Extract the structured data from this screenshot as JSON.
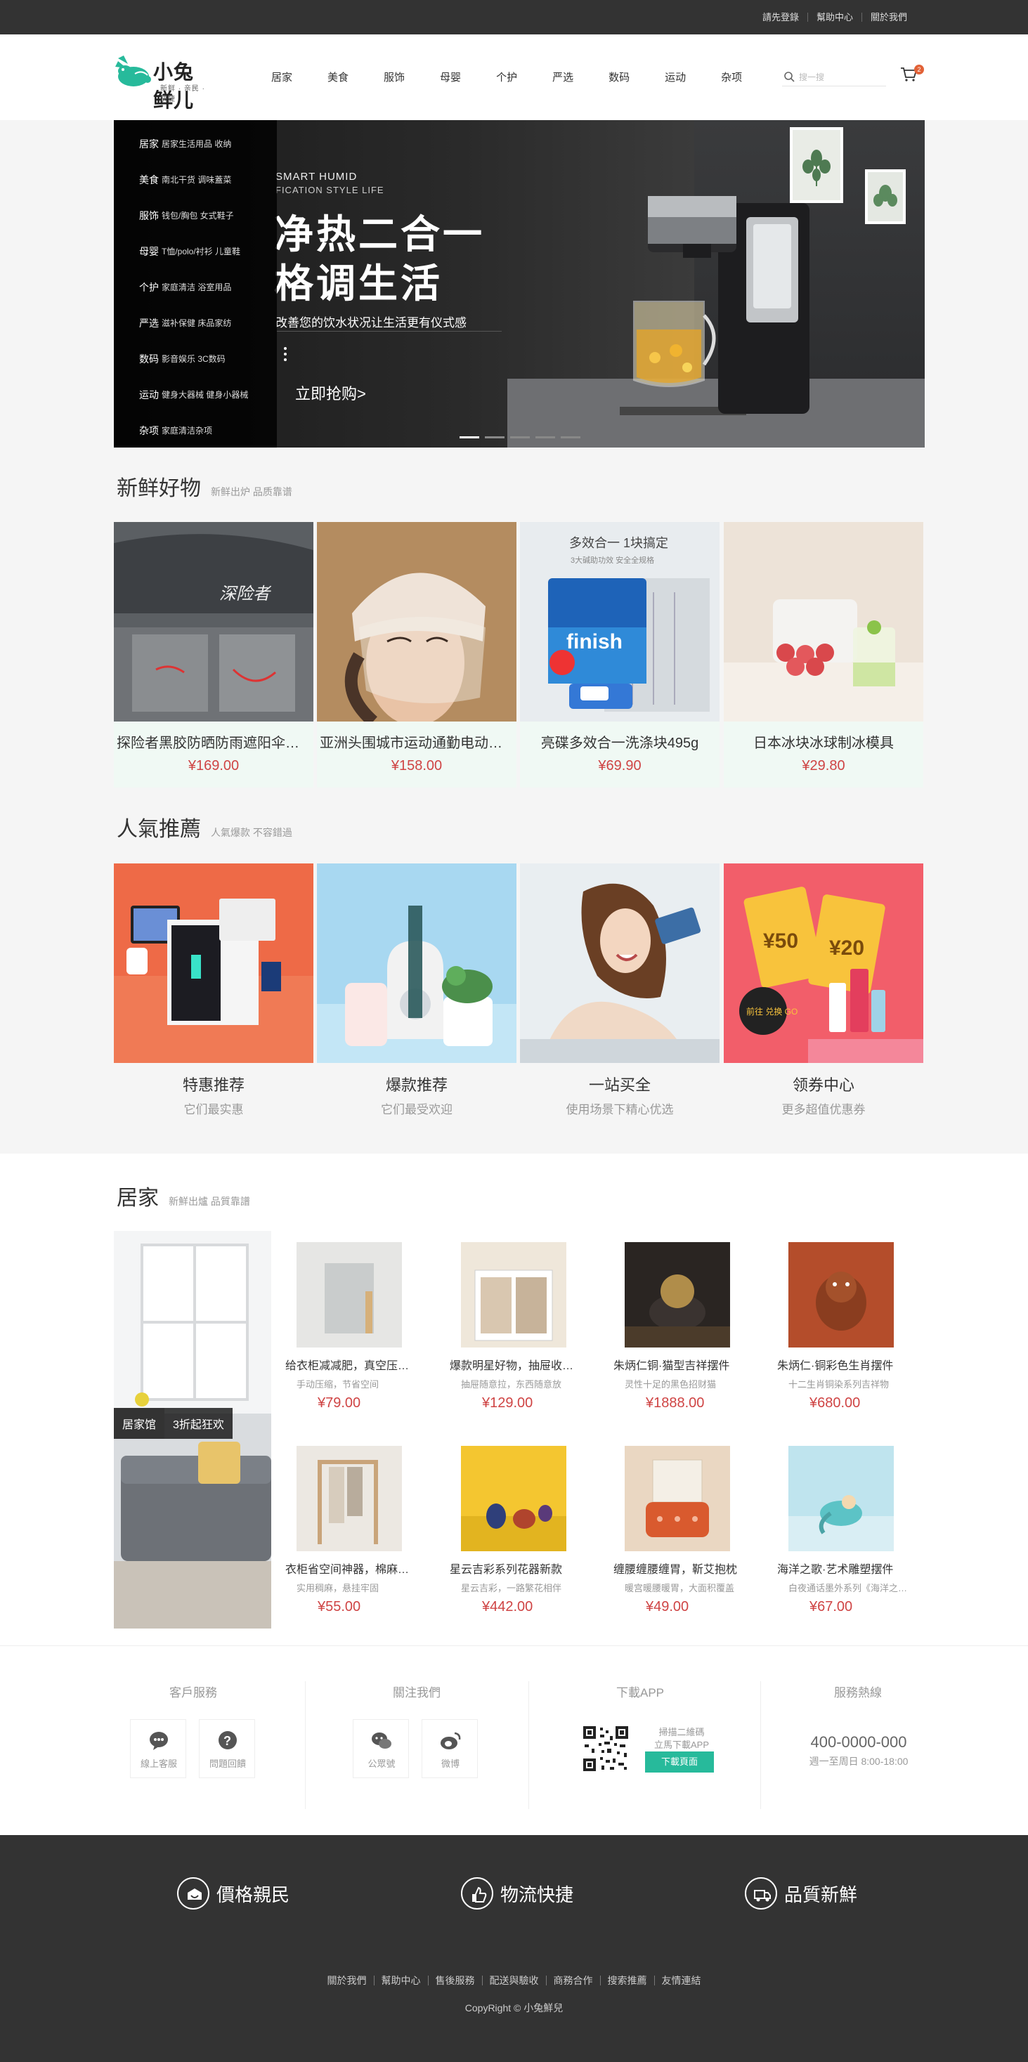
{
  "topbar": {
    "links": [
      "請先登錄",
      "幫助中心",
      "關於我們"
    ]
  },
  "header": {
    "logo_name": "小兔鲜儿",
    "logo_slogan": "新鲜 · 亲民 · 快捷",
    "nav": [
      "居家",
      "美食",
      "服饰",
      "母婴",
      "个护",
      "严选",
      "数码",
      "运动",
      "杂项"
    ],
    "search_placeholder": "搜一搜",
    "cart_count": "2"
  },
  "banner": {
    "categories": [
      {
        "name": "居家",
        "subs": "居家生活用品 收纳"
      },
      {
        "name": "美食",
        "subs": "南北干货 调味蓋菜"
      },
      {
        "name": "服饰",
        "subs": "钱包/胸包 女式鞋子"
      },
      {
        "name": "母婴",
        "subs": "T恤/polo/衬衫 儿童鞋"
      },
      {
        "name": "个护",
        "subs": "家庭清洁 浴室用品"
      },
      {
        "name": "严选",
        "subs": "滋补保健 床品家纺"
      },
      {
        "name": "数码",
        "subs": "影音娱乐 3C数码"
      },
      {
        "name": "运动",
        "subs": "健身大器械 健身小器械"
      },
      {
        "name": "杂项",
        "subs": "家庭清洁杂项"
      }
    ],
    "sub1": "SMART HUMID",
    "sub2": "FICATION STYLE LIFE",
    "headline1": "净热二合一",
    "headline2": "格调生活",
    "desc": "改善您的饮水状况让生活更有仪式感",
    "cta": "立即抢购>",
    "slides": 5,
    "active_slide": 1
  },
  "fresh": {
    "title": "新鲜好物",
    "subtitle": "新鲜出炉 品质靠谱",
    "items": [
      {
        "name": "探险者黑胶防晒防雨遮阳伞户外折叠伞",
        "price": "¥169.00"
      },
      {
        "name": "亚洲头围城市运动通勤电动车头盔",
        "price": "¥158.00"
      },
      {
        "name": "亮碟多效合一洗涤块495g",
        "price": "¥69.90"
      },
      {
        "name": "日本冰块冰球制冰模具",
        "price": "¥29.80"
      }
    ],
    "img_text": {
      "umbrella": "深险者",
      "box_top": "多效合一 1块搞定",
      "box_small": "3大碱助功效 安全全规格",
      "brand": "finish"
    }
  },
  "popular": {
    "title": "人氣推薦",
    "subtitle": "人氣爆款 不容錯過",
    "items": [
      {
        "title": "特惠推荐",
        "sub": "它们最实惠"
      },
      {
        "title": "爆款推荐",
        "sub": "它们最受欢迎"
      },
      {
        "title": "一站买全",
        "sub": "使用场景下精心优选"
      },
      {
        "title": "领券中心",
        "sub": "更多超值优惠券"
      }
    ],
    "coupon_text": {
      "big1": "¥50",
      "big2": "¥20",
      "go": "前往 兑换 GO"
    }
  },
  "home": {
    "title": "居家",
    "subtitle": "新鮮出爐 品質靠譜",
    "promo_tag1": "居家馆",
    "promo_tag2": "3折起狂欢",
    "goods": [
      {
        "name": "给衣柜减减肥，真空压缩袋",
        "desc": "手动压缩，节省空间",
        "price": "¥79.00"
      },
      {
        "name": "爆款明星好物，抽屉收纳盒",
        "desc": "抽屉随意拉，东西随意放",
        "price": "¥129.00"
      },
      {
        "name": "朱炳仁铜·猫型吉祥摆件",
        "desc": "灵性十足的黑色招财猫",
        "price": "¥1888.00"
      },
      {
        "name": "朱炳仁·铜彩色生肖摆件",
        "desc": "十二生肖铜染系列吉祥物",
        "price": "¥680.00"
      },
      {
        "name": "衣柜省空间神器，棉麻挂架",
        "desc": "实用稠麻，悬挂牢固",
        "price": "¥55.00"
      },
      {
        "name": "星云吉彩系列花器新款",
        "desc": "星云吉彩，一路繁花相伴",
        "price": "¥442.00"
      },
      {
        "name": "缠腰缠腰缠胃，靳艾抱枕",
        "desc": "暖宫暖腰暖胃，大面积覆盖",
        "price": "¥49.00"
      },
      {
        "name": "海洋之歌·艺术雕塑摆件",
        "desc": "白夜通话墨外系列《海洋之歌》",
        "price": "¥67.00"
      }
    ]
  },
  "service": {
    "col1_title": "客戶服務",
    "col1_btns": [
      "線上客服",
      "問題回饋"
    ],
    "col2_title": "關注我們",
    "col2_btns": [
      "公眾號",
      "微博"
    ],
    "col3_title": "下載APP",
    "col3_text1": "掃描二維碼",
    "col3_text2": "立馬下載APP",
    "col3_btn": "下載頁面",
    "col4_title": "服務熱線",
    "phone": "400-0000-000",
    "hours": "週一至周日 8:00-18:00"
  },
  "footer": {
    "values": [
      "價格親民",
      "物流快捷",
      "品質新鮮"
    ],
    "links": [
      "關於我們",
      "幫助中心",
      "售後服務",
      "配送與驗收",
      "商務合作",
      "搜索推薦",
      "友情連結"
    ],
    "copyright": "CopyRight © 小兔鮮兒"
  },
  "colors": {
    "brand": "#27ba9b",
    "price": "#cf4444",
    "dark": "#333333",
    "cart_badge": "#e26237"
  }
}
